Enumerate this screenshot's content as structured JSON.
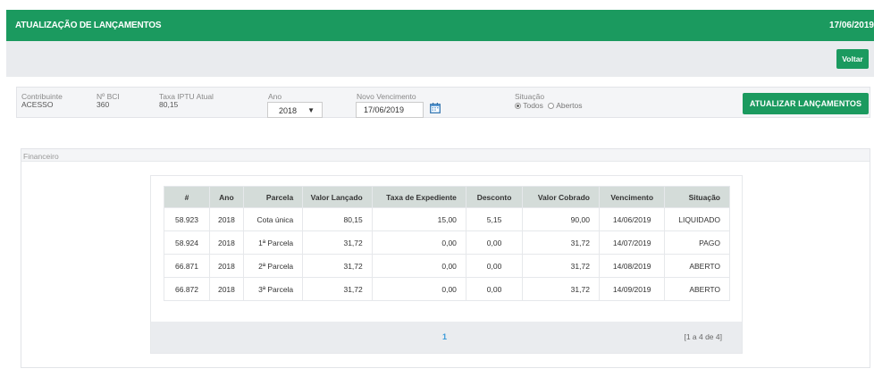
{
  "header": {
    "title": "ATUALIZAÇÃO DE LANÇAMENTOS",
    "date": "17/06/2019"
  },
  "actions": {
    "back_label": "Voltar"
  },
  "filters": {
    "contribuinte": {
      "label": "Contribuinte",
      "value": "ACESSO"
    },
    "bci": {
      "label": "Nº BCI",
      "value": "360"
    },
    "taxa": {
      "label": "Taxa IPTU Atual",
      "value": "80,15"
    },
    "ano": {
      "label": "Ano",
      "value": "2018"
    },
    "vencimento": {
      "label": "Novo Vencimento",
      "value": "17/06/2019"
    },
    "situacao": {
      "label": "Situação",
      "options": [
        "Todos",
        "Abertos"
      ],
      "selected": "Todos"
    },
    "submit_label": "ATUALIZAR LANÇAMENTOS"
  },
  "financeiro": {
    "title": "Financeiro",
    "columns": [
      "#",
      "Ano",
      "Parcela",
      "Valor Lançado",
      "Taxa de Expediente",
      "Desconto",
      "Valor Cobrado",
      "Vencimento",
      "Situação"
    ],
    "rows": [
      [
        "58.923",
        "2018",
        "Cota única",
        "80,15",
        "15,00",
        "5,15",
        "90,00",
        "14/06/2019",
        "LIQUIDADO"
      ],
      [
        "58.924",
        "2018",
        "1ª Parcela",
        "31,72",
        "0,00",
        "0,00",
        "31,72",
        "14/07/2019",
        "PAGO"
      ],
      [
        "66.871",
        "2018",
        "2ª Parcela",
        "31,72",
        "0,00",
        "0,00",
        "31,72",
        "14/08/2019",
        "ABERTO"
      ],
      [
        "66.872",
        "2018",
        "3ª Parcela",
        "31,72",
        "0,00",
        "0,00",
        "31,72",
        "14/09/2019",
        "ABERTO"
      ]
    ],
    "pagination": {
      "current": "1",
      "summary": "[1 a 4 de 4]"
    }
  },
  "icons": {
    "calendar": "calendar-icon",
    "dropdown": "caret-down-icon"
  },
  "colors": {
    "primary": "#1b9a5f",
    "table_header": "#d4dcd9",
    "link": "#3a9ad9"
  }
}
